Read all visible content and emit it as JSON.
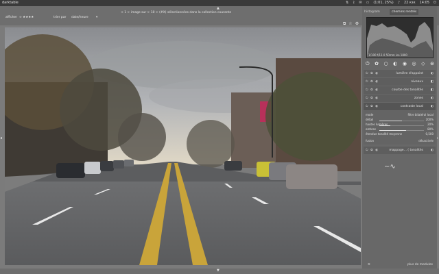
{
  "system": {
    "app_name": "darktable",
    "battery": "(1:01, 25%)",
    "volume": "22°",
    "keyboard": "22 кзк",
    "time": "14:05"
  },
  "header": {
    "filter_label": "afficher",
    "filter_value": "∞ ★★★★",
    "sort_label": "trier par",
    "sort_value": "date/heure",
    "image_info": "< 1 > image sur > 10 > (#X) sélectionnées dans la collection courante",
    "icons": [
      "display-icon",
      "star-icon",
      "gear-icon"
    ]
  },
  "right_panel": {
    "tabs": [
      "histogram",
      "chemins rentrés"
    ],
    "active_tab": 1,
    "histogram_info": "1/100 f/11.0 50mm iso 1800",
    "modules": [
      {
        "label": "lumière d'appoint",
        "end": "◐"
      },
      {
        "label": "niveaux",
        "end": "◧"
      },
      {
        "label": "courbe des tonalités",
        "end": "◧"
      },
      {
        "label": "zones",
        "end": "◐"
      },
      {
        "label": "contraste local",
        "end": "◐"
      }
    ],
    "params": [
      {
        "label": "mode",
        "value": "filtre bilatéral local"
      },
      {
        "label": "détail",
        "value": "200%"
      },
      {
        "label": "hautes lumières",
        "value": "20%"
      },
      {
        "label": "ombres",
        "value": "80%"
      },
      {
        "label": "étendue tonalité moyenne",
        "value": "0,500"
      },
      {
        "label": "fusion",
        "value": "désactivée"
      }
    ],
    "param_levels": [
      0.5,
      0.25,
      0.6,
      0.5,
      0.55
    ],
    "last_module": "mappage... ( tonalités",
    "bottom_left": "≋",
    "bottom_right": "plus de modules"
  },
  "colors": {
    "panel_bg": "#686868",
    "canvas_bg": "#7b7b7b"
  }
}
